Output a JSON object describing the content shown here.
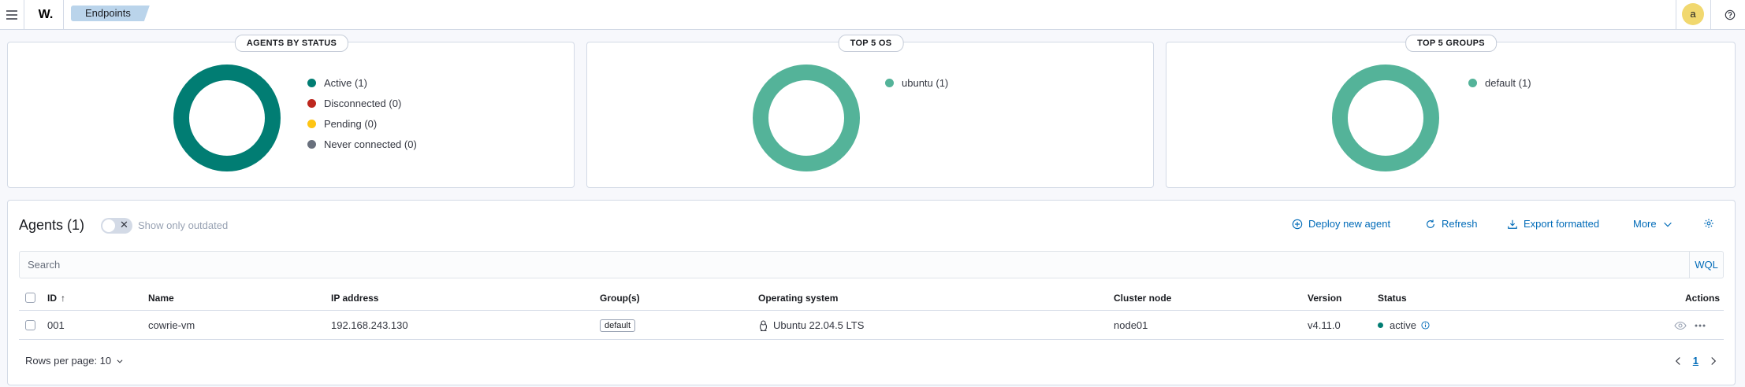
{
  "header": {
    "logo": "W.",
    "breadcrumb": "Endpoints",
    "avatar_initial": "a"
  },
  "panels": {
    "agents_by_status": {
      "title": "AGENTS BY STATUS",
      "legend": [
        {
          "label": "Active (1)",
          "color": "#017d73"
        },
        {
          "label": "Disconnected (0)",
          "color": "#bd271e"
        },
        {
          "label": "Pending (0)",
          "color": "#fec514"
        },
        {
          "label": "Never connected (0)",
          "color": "#69707d"
        }
      ]
    },
    "top_os": {
      "title": "TOP 5 OS",
      "legend": [
        {
          "label": "ubuntu (1)",
          "color": "#54b399"
        }
      ]
    },
    "top_groups": {
      "title": "TOP 5 GROUPS",
      "legend": [
        {
          "label": "default (1)",
          "color": "#54b399"
        }
      ]
    }
  },
  "chart_data": [
    {
      "type": "pie",
      "title": "AGENTS BY STATUS",
      "categories": [
        "Active",
        "Disconnected",
        "Pending",
        "Never connected"
      ],
      "values": [
        1,
        0,
        0,
        0
      ]
    },
    {
      "type": "pie",
      "title": "TOP 5 OS",
      "categories": [
        "ubuntu"
      ],
      "values": [
        1
      ]
    },
    {
      "type": "pie",
      "title": "TOP 5 GROUPS",
      "categories": [
        "default"
      ],
      "values": [
        1
      ]
    }
  ],
  "agents": {
    "title": "Agents (1)",
    "toggle_label": "Show only outdated",
    "actions": {
      "deploy": "Deploy new agent",
      "refresh": "Refresh",
      "export": "Export formatted",
      "more": "More"
    },
    "search": {
      "placeholder": "Search",
      "wql": "WQL"
    },
    "columns": [
      "ID",
      "Name",
      "IP address",
      "Group(s)",
      "Operating system",
      "Cluster node",
      "Version",
      "Status",
      "Actions"
    ],
    "rows": [
      {
        "id": "001",
        "name": "cowrie-vm",
        "ip": "192.168.243.130",
        "group": "default",
        "os": "Ubuntu 22.04.5 LTS",
        "node": "node01",
        "version": "v4.11.0",
        "status": "active"
      }
    ],
    "rows_per_page": "Rows per page: 10",
    "current_page": "1"
  }
}
